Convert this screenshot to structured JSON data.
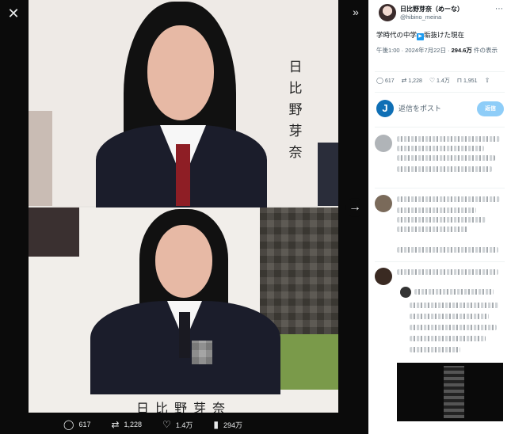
{
  "viewer": {
    "photo_labels": {
      "top_vertical_name": [
        "日",
        "比",
        "野",
        "芽",
        "奈"
      ],
      "bottom_name": "日比野芽奈"
    },
    "actions": {
      "replies": "617",
      "reposts": "1,228",
      "likes": "1.4万",
      "views": "294万"
    }
  },
  "tweet": {
    "author_name": "日比野芽奈（めーな）",
    "author_handle": "@hibino_meina",
    "text_before": "学時代の中学",
    "text_after": "垢抜けた現在",
    "time": "午後1:00 · 2024年7月22日 · ",
    "views_count": "294.6万",
    "views_label": " 件の表示",
    "stats": {
      "replies": "617",
      "reposts": "1,228",
      "likes": "1.4万",
      "bookmarks": "1,951"
    },
    "reply_placeholder": "返信をポスト",
    "reply_button": "返信",
    "reply_avatar_letter": "J"
  }
}
